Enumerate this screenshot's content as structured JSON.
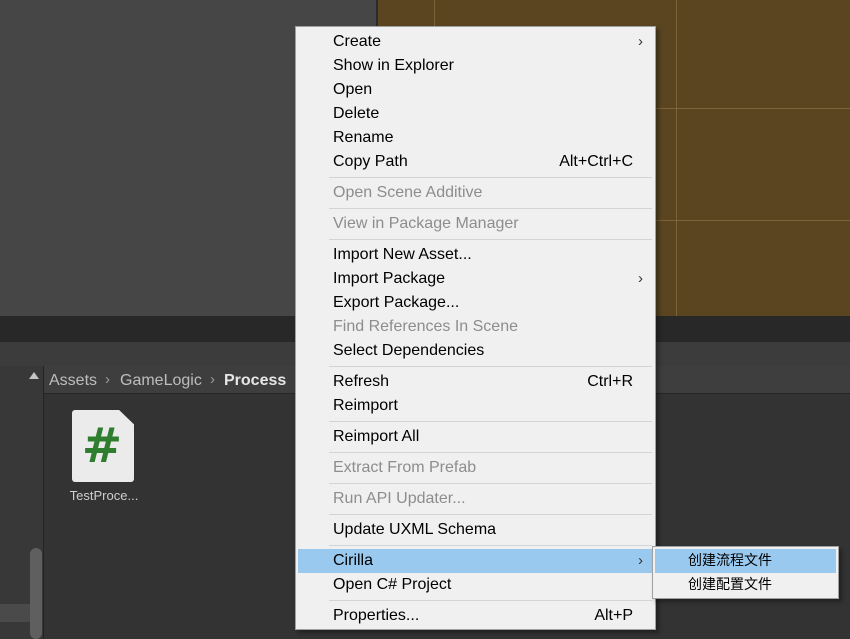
{
  "breadcrumb": [
    "Assets",
    "GameLogic",
    "Process"
  ],
  "file": {
    "icon": "csharp-script-icon",
    "glyph": "#",
    "label": "TestProce..."
  },
  "context_menu": {
    "items": [
      {
        "label": "Create",
        "shortcut": "",
        "submenu": true,
        "disabled": false
      },
      {
        "label": "Show in Explorer",
        "shortcut": "",
        "submenu": false,
        "disabled": false
      },
      {
        "label": "Open",
        "shortcut": "",
        "submenu": false,
        "disabled": false
      },
      {
        "label": "Delete",
        "shortcut": "",
        "submenu": false,
        "disabled": false
      },
      {
        "label": "Rename",
        "shortcut": "",
        "submenu": false,
        "disabled": false
      },
      {
        "label": "Copy Path",
        "shortcut": "Alt+Ctrl+C",
        "submenu": false,
        "disabled": false
      },
      {
        "label": "Open Scene Additive",
        "shortcut": "",
        "submenu": false,
        "disabled": true
      },
      {
        "label": "View in Package Manager",
        "shortcut": "",
        "submenu": false,
        "disabled": true
      },
      {
        "label": "Import New Asset...",
        "shortcut": "",
        "submenu": false,
        "disabled": false
      },
      {
        "label": "Import Package",
        "shortcut": "",
        "submenu": true,
        "disabled": false
      },
      {
        "label": "Export Package...",
        "shortcut": "",
        "submenu": false,
        "disabled": false
      },
      {
        "label": "Find References In Scene",
        "shortcut": "",
        "submenu": false,
        "disabled": true
      },
      {
        "label": "Select Dependencies",
        "shortcut": "",
        "submenu": false,
        "disabled": false
      },
      {
        "label": "Refresh",
        "shortcut": "Ctrl+R",
        "submenu": false,
        "disabled": false
      },
      {
        "label": "Reimport",
        "shortcut": "",
        "submenu": false,
        "disabled": false
      },
      {
        "label": "Reimport All",
        "shortcut": "",
        "submenu": false,
        "disabled": false
      },
      {
        "label": "Extract From Prefab",
        "shortcut": "",
        "submenu": false,
        "disabled": true
      },
      {
        "label": "Run API Updater...",
        "shortcut": "",
        "submenu": false,
        "disabled": true
      },
      {
        "label": "Update UXML Schema",
        "shortcut": "",
        "submenu": false,
        "disabled": false
      },
      {
        "label": "Cirilla",
        "shortcut": "",
        "submenu": true,
        "disabled": false,
        "highlighted": true
      },
      {
        "label": "Open C# Project",
        "shortcut": "",
        "submenu": false,
        "disabled": false
      },
      {
        "label": "Properties...",
        "shortcut": "Alt+P",
        "submenu": false,
        "disabled": false
      }
    ],
    "submenu_arrow": "›"
  },
  "cirilla_submenu": {
    "items": [
      {
        "label": "创建流程文件",
        "highlighted": true
      },
      {
        "label": "创建配置文件",
        "highlighted": false
      }
    ]
  },
  "colors": {
    "menu_bg": "#f0f0f0",
    "highlight": "#99c9ef",
    "disabled_text": "#8d8d8d",
    "editor_bg": "#383838",
    "scene_bg": "#5a4520",
    "script_icon_green": "#2f7d2f"
  }
}
